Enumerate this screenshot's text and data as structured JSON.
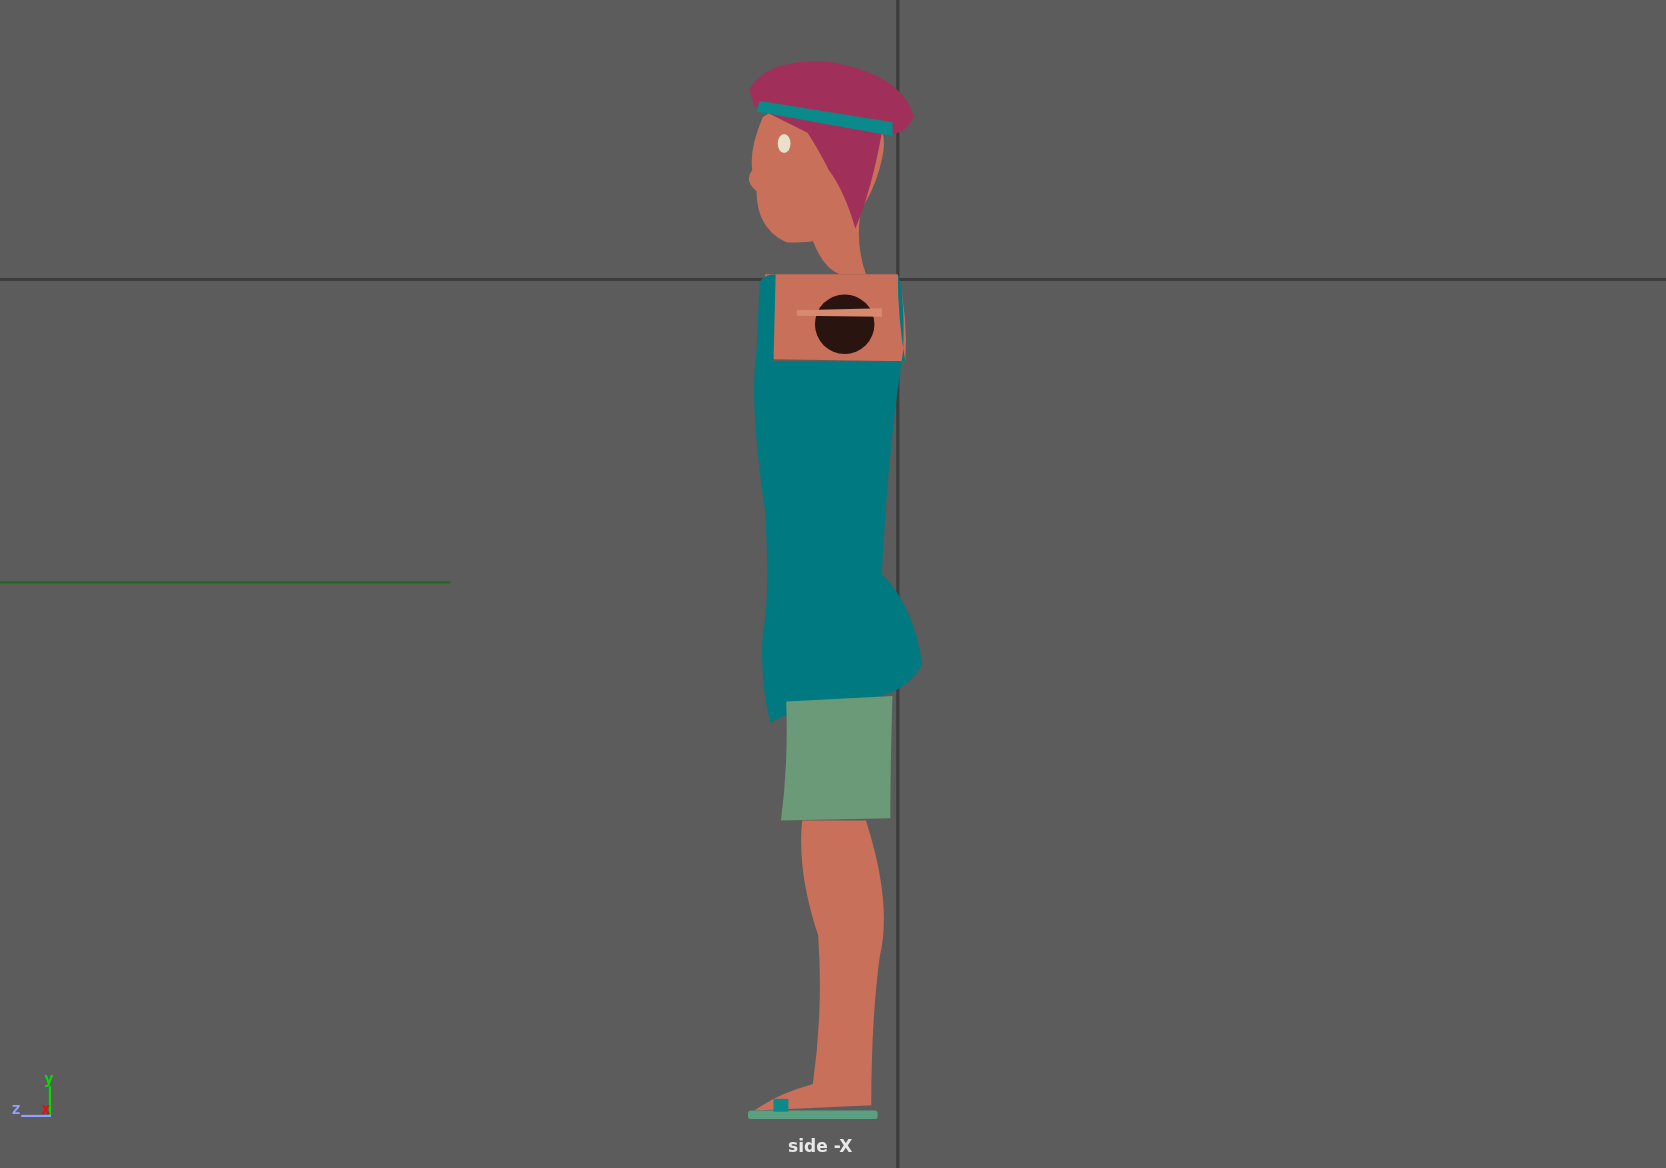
{
  "viewport": {
    "camera_label": "side -X"
  },
  "axes": [
    {
      "label": "y",
      "color": "#00e000"
    },
    {
      "label": "z",
      "color": "#8fa0ff"
    },
    {
      "label": "x",
      "color": "#e01010"
    }
  ]
}
